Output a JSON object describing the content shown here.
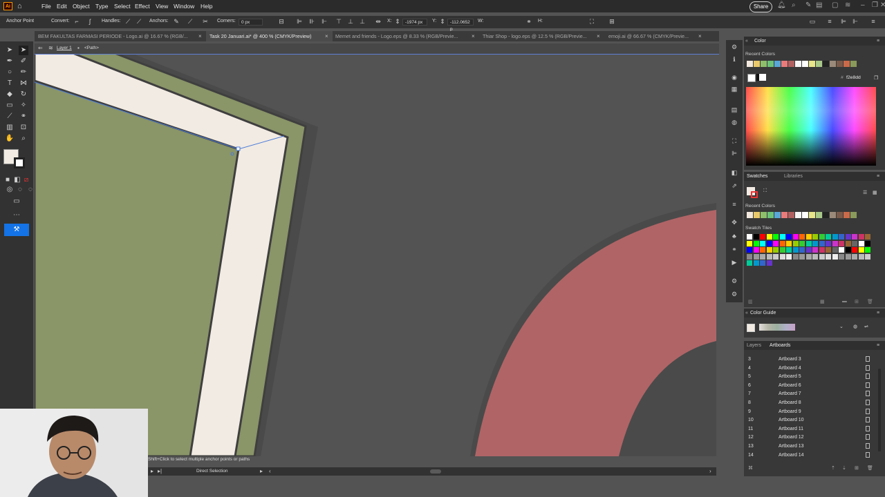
{
  "menubar": {
    "logo": "Ai",
    "items": [
      "File",
      "Edit",
      "Object",
      "Type",
      "Select",
      "Effect",
      "View",
      "Window",
      "Help"
    ],
    "share_label": "Share"
  },
  "controlbar": {
    "mode_label": "Anchor Point",
    "convert_label": "Convert:",
    "handles_label": "Handles:",
    "anchors_label": "Anchors:",
    "corners_label": "Corners:",
    "corners_value": "0 px",
    "x_label": "X:",
    "x_value": "-1974 px",
    "y_label": "Y:",
    "y_value": "-112.0652 p",
    "w_label": "W:",
    "h_label": "H:"
  },
  "tabs": [
    {
      "label": "BEM FAKULTAS FARMASI PERIODE - Logo.ai @ 16.67 % (RGB/...",
      "active": false
    },
    {
      "label": "Task 20 Januari.ai* @ 400 % (CMYK/Preview)",
      "active": true
    },
    {
      "label": "Memet and friends - Logo.eps @ 8.33 % (RGB/Previe...",
      "active": false
    },
    {
      "label": "Thiar Shop - logo.eps @ 12.5 % (RGB/Previe...",
      "active": false
    },
    {
      "label": "emoji.ai @ 66.67 % (CMYK/Previe...",
      "active": false
    }
  ],
  "breadcrumb": {
    "layer": "Layer 1",
    "path": "<Path>"
  },
  "status": {
    "hint": "Shift+Click to select multiple anchor points or paths",
    "tool": "Direct Selection"
  },
  "color_panel": {
    "title": "Color",
    "recent_label": "Recent Colors",
    "hex_value": "f2e8dd",
    "recent_colors": [
      "#f2e8dd",
      "#e8c96b",
      "#8fbf6b",
      "#6dc27a",
      "#58a7d6",
      "#e97b7b",
      "#b06060",
      "#f5f5f5",
      "#ffffff",
      "#e8e68a",
      "#a8c88a",
      "#222222",
      "#9a8a7a",
      "#7a5a4a",
      "#c96a4a",
      "#8a9a5a"
    ]
  },
  "swatches_panel": {
    "tabs": [
      "Swatches",
      "Libraries"
    ],
    "recent_label": "Recent Colors",
    "tiles_label": "Swatch Tiles"
  },
  "color_guide": {
    "title": "Color Guide"
  },
  "artboards_panel": {
    "tabs": [
      "Layers",
      "Artboards"
    ],
    "rows": [
      {
        "num": "3",
        "name": "Artboard 3"
      },
      {
        "num": "4",
        "name": "Artboard 4"
      },
      {
        "num": "5",
        "name": "Artboard 5"
      },
      {
        "num": "6",
        "name": "Artboard 6"
      },
      {
        "num": "7",
        "name": "Artboard 7"
      },
      {
        "num": "8",
        "name": "Artboard 8"
      },
      {
        "num": "9",
        "name": "Artboard 9"
      },
      {
        "num": "10",
        "name": "Artboard 10"
      },
      {
        "num": "11",
        "name": "Artboard 11"
      },
      {
        "num": "12",
        "name": "Artboard 12"
      },
      {
        "num": "13",
        "name": "Artboard 13"
      },
      {
        "num": "14",
        "name": "Artboard 14"
      }
    ]
  },
  "colors": {
    "olive": "#8a9568",
    "cream": "#f2ebe3",
    "rose": "#b06466",
    "dark_outline": "#3f3f3f",
    "selection": "#4a7ad8"
  }
}
